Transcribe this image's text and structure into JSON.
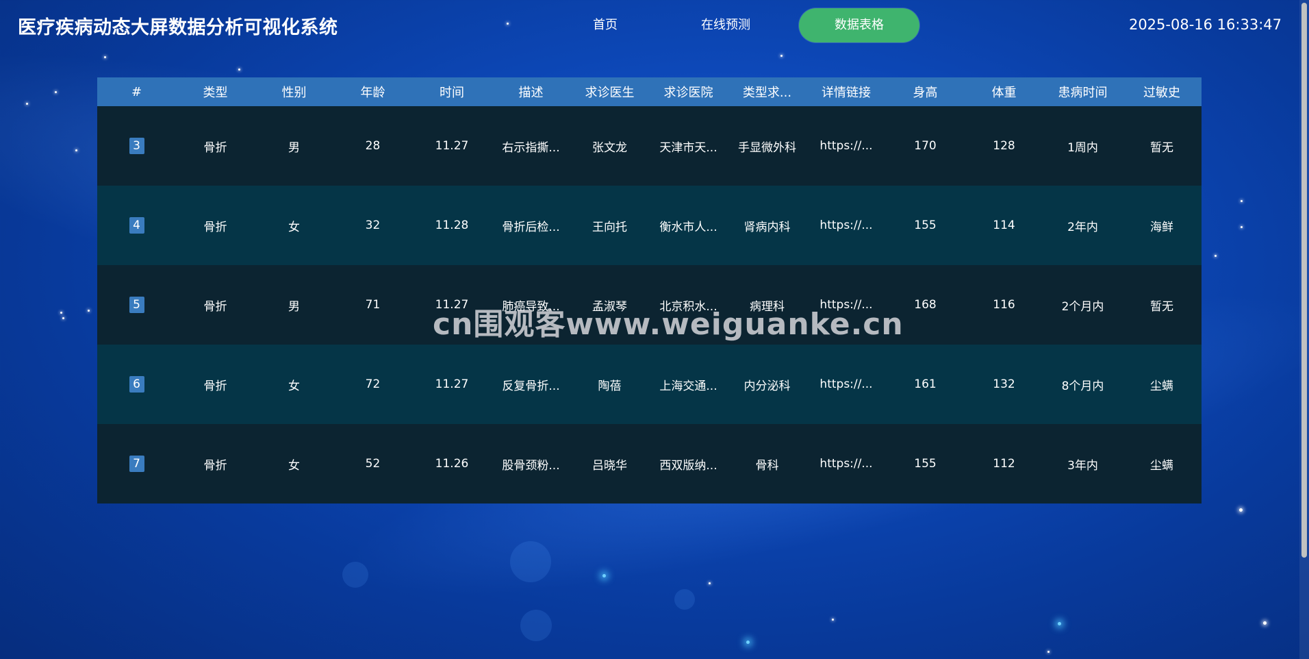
{
  "header": {
    "app_title": "医疗疾病动态大屏数据分析可视化系统",
    "nav": [
      {
        "label": "首页",
        "active": false
      },
      {
        "label": "在线预测",
        "active": false
      },
      {
        "label": "数据表格",
        "active": true
      }
    ],
    "datetime": "2025-08-16 16:33:47"
  },
  "table": {
    "columns": [
      "#",
      "类型",
      "性别",
      "年龄",
      "时间",
      "描述",
      "求诊医生",
      "求诊医院",
      "类型求...",
      "详情链接",
      "身高",
      "体重",
      "患病时间",
      "过敏史"
    ],
    "rows": [
      [
        "3",
        "骨折",
        "男",
        "28",
        "11.27",
        "右示指撕...",
        "张文龙",
        "天津市天...",
        "手显微外科",
        "https://...",
        "170",
        "128",
        "1周内",
        "暂无"
      ],
      [
        "4",
        "骨折",
        "女",
        "32",
        "11.28",
        "骨折后检...",
        "王向托",
        "衡水市人...",
        "肾病内科",
        "https://...",
        "155",
        "114",
        "2年内",
        "海鲜"
      ],
      [
        "5",
        "骨折",
        "男",
        "71",
        "11.27",
        "肺癌导致...",
        "孟淑琴",
        "北京积水...",
        "病理科",
        "https://...",
        "168",
        "116",
        "2个月内",
        "暂无"
      ],
      [
        "6",
        "骨折",
        "女",
        "72",
        "11.27",
        "反复骨折...",
        "陶蓓",
        "上海交通...",
        "内分泌科",
        "https://...",
        "161",
        "132",
        "8个月内",
        "尘螨"
      ],
      [
        "7",
        "骨折",
        "女",
        "52",
        "11.26",
        "股骨颈粉...",
        "吕晓华",
        "西双版纳...",
        "骨科",
        "https://...",
        "155",
        "112",
        "3年内",
        "尘螨"
      ]
    ]
  },
  "watermark": "cn围观客www.weiguanke.cn",
  "colors": {
    "nav_active": "#3fb46e",
    "table_header": "#2f72b8",
    "row_odd": "#0c2431",
    "row_even": "#053547",
    "index_badge": "#3a7cbf"
  }
}
